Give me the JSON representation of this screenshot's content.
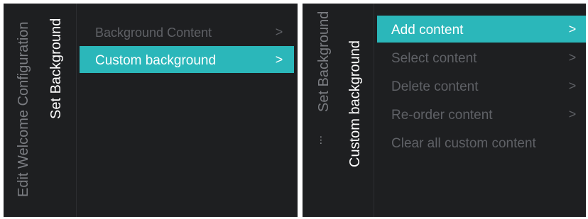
{
  "left_panel": {
    "breadcrumb_title": "Edit Welcome Configuration",
    "current_title": "Set Background",
    "menu": [
      {
        "label": "Background Content",
        "chevron": ">"
      },
      {
        "label": "Custom background",
        "chevron": ">"
      }
    ]
  },
  "right_panel": {
    "ellipsis": "...",
    "breadcrumb_title": "Set Background",
    "current_title": "Custom background",
    "menu": [
      {
        "label": "Add content",
        "chevron": ">"
      },
      {
        "label": "Select content",
        "chevron": ">"
      },
      {
        "label": "Delete content",
        "chevron": ">"
      },
      {
        "label": "Re-order content",
        "chevron": ">"
      },
      {
        "label": "Clear all custom content",
        "chevron": ""
      }
    ]
  },
  "colors": {
    "panel_background": "#1e1f21",
    "selection_accent": "#2bb7ba",
    "dim_text": "#5f6166"
  }
}
